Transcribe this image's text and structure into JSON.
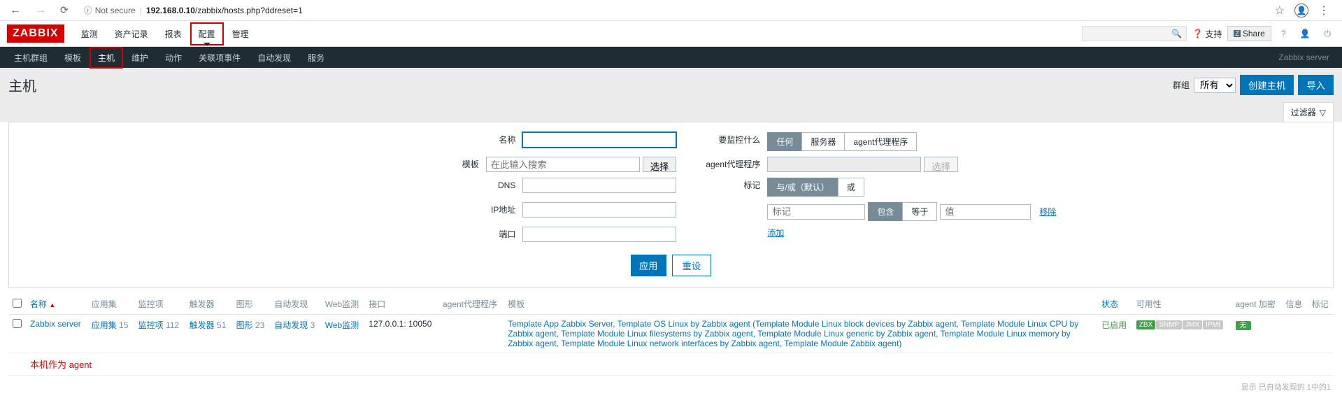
{
  "browser": {
    "not_secure": "Not secure",
    "url_prefix": "192.168.0.10",
    "url_path": "/zabbix/hosts.php?ddreset=1"
  },
  "logo": "ZABBIX",
  "main_nav": [
    "监测",
    "资产记录",
    "报表",
    "配置",
    "管理"
  ],
  "header_right": {
    "support": "支持",
    "share": "Share"
  },
  "sub_nav": [
    "主机群组",
    "模板",
    "主机",
    "维护",
    "动作",
    "关联项事件",
    "自动发现",
    "服务"
  ],
  "sub_nav_right": "Zabbix server",
  "page_title": "主机",
  "page_actions": {
    "group_label": "群组",
    "group_selected": "所有",
    "create": "创建主机",
    "import": "导入"
  },
  "filter_tab": "过滤器",
  "filter": {
    "name_label": "名称",
    "template_label": "模板",
    "template_placeholder": "在此输入搜索",
    "select_btn": "选择",
    "dns_label": "DNS",
    "ip_label": "IP地址",
    "port_label": "端口",
    "monitor_label": "要监控什么",
    "monitor_opts": [
      "任何",
      "服务器",
      "agent代理程序"
    ],
    "proxy_label": "agent代理程序",
    "tags_label": "标记",
    "tags_opts": [
      "与/或（默认）",
      "或"
    ],
    "tag_placeholder": "标记",
    "tag_op_opts": [
      "包含",
      "等于"
    ],
    "tag_value_placeholder": "值",
    "remove": "移除",
    "add": "添加",
    "apply": "应用",
    "reset": "重设"
  },
  "table": {
    "headers": {
      "name": "名称",
      "apps": "应用集",
      "items": "监控项",
      "triggers": "触发器",
      "graphs": "图形",
      "discovery": "自动发现",
      "web": "Web监测",
      "interface": "接口",
      "proxy": "agent代理程序",
      "templates": "模板",
      "status": "状态",
      "availability": "可用性",
      "agent_enc": "agent 加密",
      "info": "信息",
      "tags": "标记"
    },
    "row": {
      "name": "Zabbix server",
      "apps_label": "应用集",
      "apps_count": "15",
      "items_label": "监控项",
      "items_count": "112",
      "triggers_label": "触发器",
      "triggers_count": "51",
      "graphs_label": "图形",
      "graphs_count": "23",
      "discovery_label": "自动发现",
      "discovery_count": "3",
      "web_label": "Web监测",
      "interface": "127.0.0.1: 10050",
      "templates_text": "Template App Zabbix Server, Template OS Linux by Zabbix agent (Template Module Linux block devices by Zabbix agent, Template Module Linux CPU by Zabbix agent, Template Module Linux filesystems by Zabbix agent, Template Module Linux generic by Zabbix agent, Template Module Linux memory by Zabbix agent, Template Module Linux network interfaces by Zabbix agent, Template Module Zabbix agent)",
      "status": "已启用",
      "avail": {
        "zbx": "ZBX",
        "snmp": "SNMP",
        "jmx": "JMX",
        "ipmi": "IPMI"
      },
      "enc": "无"
    }
  },
  "annotation": "本机作为 agent",
  "footer": "显示 已自动发现的 1中的1"
}
